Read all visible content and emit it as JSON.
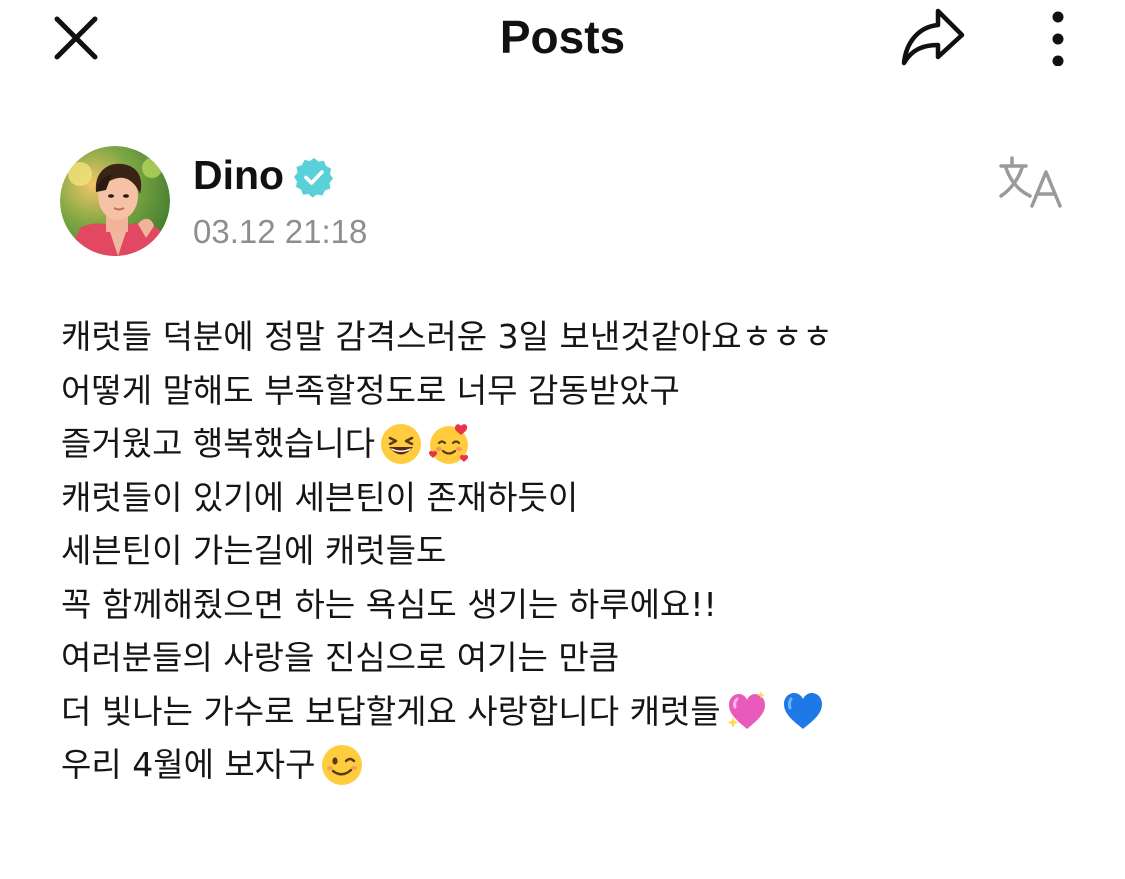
{
  "header": {
    "title": "Posts",
    "close_icon": "close-icon",
    "share_icon": "share-arrow-icon",
    "more_icon": "more-vertical-icon"
  },
  "post": {
    "author": "Dino",
    "verified_icon": "verified-badge-icon",
    "timestamp": "03.12 21:18",
    "translate_icon": "translate-icon",
    "lines": [
      {
        "text": "캐럿들 덕분에 정말 감격스러운 3일 보낸것같아요ㅎㅎㅎ",
        "emojis": []
      },
      {
        "text": "어떻게 말해도 부족할정도로 너무 감동받았구",
        "emojis": []
      },
      {
        "text": "즐거웠고 행복했습니다",
        "emojis": [
          "grinning-squinting-face-emoji",
          "smiling-face-with-hearts-emoji"
        ]
      },
      {
        "text": "캐럿들이 있기에 세븐틴이 존재하듯이",
        "emojis": []
      },
      {
        "text": "세븐틴이 가는길에 캐럿들도",
        "emojis": []
      },
      {
        "text": "꼭 함께해줬으면 하는 욕심도 생기는 하루에요!!",
        "emojis": []
      },
      {
        "text": "여러분들의 사랑을 진심으로 여기는 만큼",
        "emojis": []
      },
      {
        "text": "더 빛나는 가수로 보답할게요 사랑합니다 캐럿들",
        "emojis": [
          "sparkling-heart-emoji",
          "blue-heart-emoji"
        ]
      },
      {
        "text": "우리 4월에 보자구",
        "emojis": [
          "winking-face-emoji"
        ]
      }
    ]
  },
  "colors": {
    "verified": "#5ad1d8",
    "muted_text": "#8e8e8e",
    "icon_gray": "#9a9a9a"
  }
}
